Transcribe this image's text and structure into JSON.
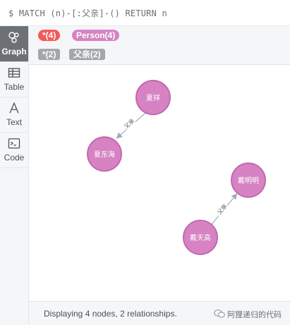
{
  "query": {
    "text": "$ MATCH (n)-[:父亲]-() RETURN n"
  },
  "sidebar": {
    "items": [
      {
        "label": "Graph",
        "icon": "graph-icon",
        "active": true
      },
      {
        "label": "Table",
        "icon": "table-icon",
        "active": false
      },
      {
        "label": "Text",
        "icon": "text-icon",
        "active": false
      },
      {
        "label": "Code",
        "icon": "code-icon",
        "active": false
      }
    ]
  },
  "legend": {
    "node_labels": [
      {
        "text": "*(4)",
        "color": "#f25a5a"
      },
      {
        "text": "Person(4)",
        "color": "#d682c3"
      }
    ],
    "relationship_types": [
      {
        "text": "*(2)",
        "color": "#a3a7ad"
      },
      {
        "text": "父亲(2)",
        "color": "#a3a7ad"
      }
    ]
  },
  "graph": {
    "node_color": "#d682c3",
    "node_border": "#c06aae",
    "edge_color": "#a5abb6",
    "nodes": [
      {
        "id": "n1",
        "name": "夏祥"
      },
      {
        "id": "n2",
        "name": "夏东海"
      },
      {
        "id": "n3",
        "name": "戴明明"
      },
      {
        "id": "n4",
        "name": "戴天高"
      }
    ],
    "relationships": [
      {
        "from": "n1",
        "to": "n2",
        "type": "父亲"
      },
      {
        "from": "n4",
        "to": "n3",
        "type": "父亲"
      }
    ]
  },
  "footer": {
    "status": "Displaying 4 nodes, 2 relationships."
  },
  "watermark": {
    "text": "阿狸递归的代码"
  }
}
